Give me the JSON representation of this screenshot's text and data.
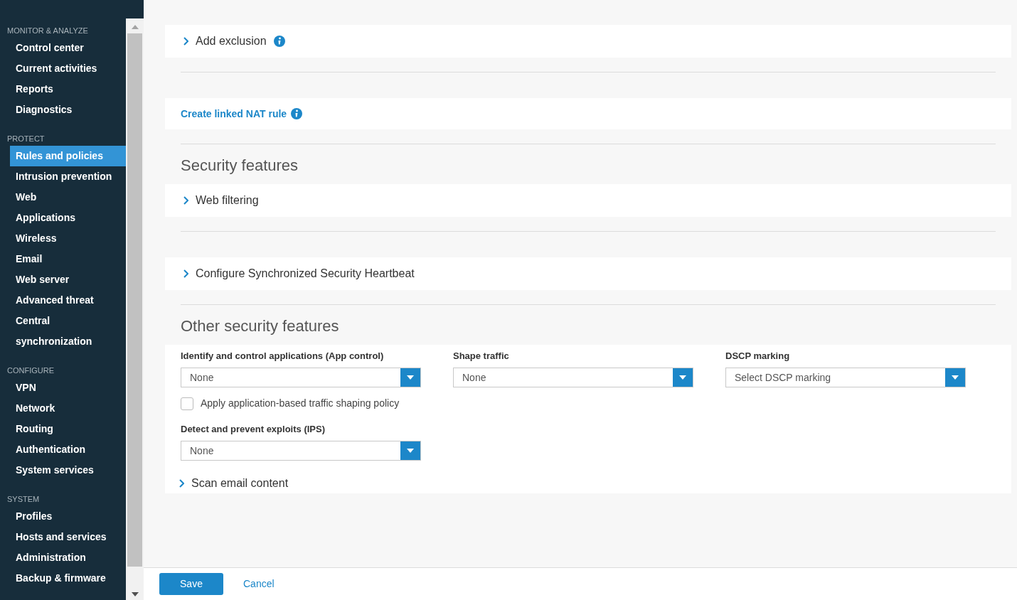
{
  "sidebar": {
    "sections": [
      {
        "title": "MONITOR & ANALYZE",
        "items": [
          {
            "label": "Control center",
            "selected": false
          },
          {
            "label": "Current activities",
            "selected": false
          },
          {
            "label": "Reports",
            "selected": false
          },
          {
            "label": "Diagnostics",
            "selected": false
          }
        ]
      },
      {
        "title": "PROTECT",
        "items": [
          {
            "label": "Rules and policies",
            "selected": true
          },
          {
            "label": "Intrusion prevention",
            "selected": false
          },
          {
            "label": "Web",
            "selected": false
          },
          {
            "label": "Applications",
            "selected": false
          },
          {
            "label": "Wireless",
            "selected": false
          },
          {
            "label": "Email",
            "selected": false
          },
          {
            "label": "Web server",
            "selected": false
          },
          {
            "label": "Advanced threat",
            "selected": false
          },
          {
            "label": "Central synchronization",
            "selected": false
          }
        ]
      },
      {
        "title": "CONFIGURE",
        "items": [
          {
            "label": "VPN",
            "selected": false
          },
          {
            "label": "Network",
            "selected": false
          },
          {
            "label": "Routing",
            "selected": false
          },
          {
            "label": "Authentication",
            "selected": false
          },
          {
            "label": "System services",
            "selected": false
          }
        ]
      },
      {
        "title": "SYSTEM",
        "items": [
          {
            "label": "Profiles",
            "selected": false
          },
          {
            "label": "Hosts and services",
            "selected": false
          },
          {
            "label": "Administration",
            "selected": false
          },
          {
            "label": "Backup & firmware",
            "selected": false
          }
        ]
      }
    ]
  },
  "blocks": [
    {
      "kind": "expander",
      "label": "Add exclusion",
      "info": true
    },
    {
      "kind": "link",
      "label": "Create linked NAT rule",
      "info": true
    },
    {
      "kind": "heading",
      "label": "Security features"
    },
    {
      "kind": "expander",
      "label": "Web filtering",
      "info": false
    },
    {
      "kind": "expander",
      "label": "Configure Synchronized Security Heartbeat",
      "info": false
    },
    {
      "kind": "heading",
      "label": "Other security features"
    },
    {
      "kind": "panel",
      "fields": [
        {
          "kind": "select",
          "label": "Identify and control applications (App control)",
          "value": "None"
        },
        {
          "kind": "select",
          "label": "Shape traffic",
          "value": "None"
        },
        {
          "kind": "select",
          "label": "DSCP marking",
          "value": "Select DSCP marking"
        },
        {
          "kind": "checkbox",
          "label": "Apply application-based traffic shaping policy",
          "checked": false
        },
        {
          "kind": "select",
          "label": "Detect and prevent exploits (IPS)",
          "value": "None"
        }
      ],
      "expander": {
        "label": "Scan email content"
      }
    }
  ],
  "footer": {
    "buttons": [
      {
        "kind": "primary",
        "label": "Save"
      },
      {
        "kind": "link",
        "label": "Cancel"
      }
    ]
  }
}
